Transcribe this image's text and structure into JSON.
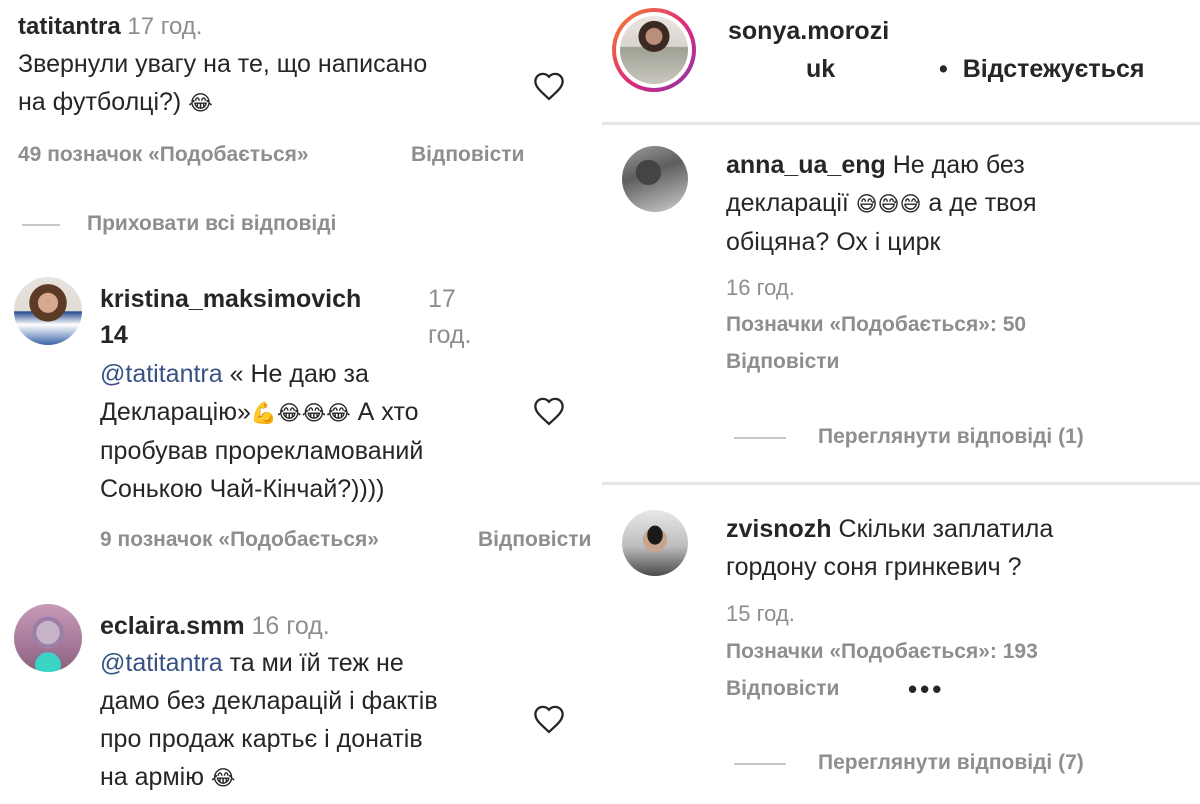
{
  "left": {
    "top_comment": {
      "username": "tatitantra",
      "time": "17 год.",
      "text_line1": "Звернули увагу на те, що написано",
      "text_line2": "на футболці?)",
      "emoji": "😂",
      "likes": "49 позначок «Подобається»",
      "reply": "Відповісти"
    },
    "hide_replies": "Приховати всі відповіді",
    "reply1": {
      "username_line1": "kristina_maksimovich",
      "username_line2": "14",
      "time_line1": "17",
      "time_line2": "год.",
      "mention": "@tatitantra",
      "text_line1": " « Не даю за",
      "text_line2": "Декларацію»",
      "emojis_line2": "💪😂😂😂",
      "text_line2b": " А хто",
      "text_line3": "пробував прорекламований",
      "text_line4": "Сонькою Чай-Кінчай?))))",
      "likes": "9 позначок «Подобається»",
      "reply": "Відповісти"
    },
    "reply2": {
      "username": "eclaira.smm",
      "time": "16 год.",
      "mention": "@tatitantra",
      "text_line1": " та ми їй теж не",
      "text_line2": "дамо без декларацій і фактів",
      "text_line3": "про продаж картьє і донатів",
      "text_line4": "на армію",
      "emoji": "😂"
    }
  },
  "right": {
    "header": {
      "username_line1": "sonya.morozi",
      "username_line2": "uk",
      "bullet": "•",
      "follow_status": "Відстежується"
    },
    "comment1": {
      "username": "anna_ua_eng",
      "text_line1": " Не даю без",
      "text_line2": "декларації",
      "emojis": "😅😅😅",
      "text_line2b": " а де твоя",
      "text_line3": "обіцяна? Ох і цирк",
      "time": "16 год.",
      "likes": "Позначки «Подобається»: 50",
      "reply": "Відповісти",
      "view_replies": "Переглянути відповіді (1)"
    },
    "comment2": {
      "username": "zvisnozh",
      "text_line1": " Скільки заплатила",
      "text_line2": "гордону соня гринкевич ?",
      "time": "15 год.",
      "likes": "Позначки «Подобається»: 193",
      "reply": "Відповісти",
      "more": "•••",
      "view_replies": "Переглянути відповіді (7)"
    }
  },
  "colors": {
    "text": "#262626",
    "secondary": "#8e8e8e",
    "mention": "#385185",
    "story_ring_start": "#f58529",
    "story_ring_end": "#dd2a7b"
  },
  "icons": [
    "heart-outline-icon",
    "avatar-image"
  ]
}
